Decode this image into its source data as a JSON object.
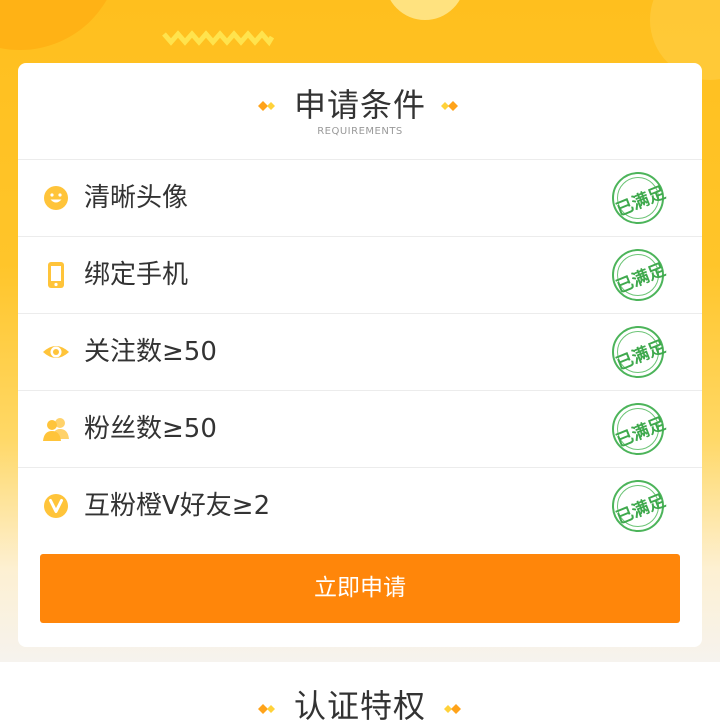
{
  "colors": {
    "accent": "#ff860a",
    "stamp_green": "#4cb45a",
    "icon_yellow": "#ffc43a",
    "hero_yellow": "#ffbf1e"
  },
  "requirements_card": {
    "title": "申请条件",
    "subtitle": "REQUIREMENTS",
    "items": [
      {
        "label": "清晰头像",
        "icon": "smiley-icon",
        "status": "已满足"
      },
      {
        "label": "绑定手机",
        "icon": "phone-icon",
        "status": "已满足"
      },
      {
        "label": "关注数≥50",
        "icon": "eye-icon",
        "status": "已满足"
      },
      {
        "label": "粉丝数≥50",
        "icon": "users-icon",
        "status": "已满足"
      },
      {
        "label": "互粉橙V好友≥2",
        "icon": "v-badge-icon",
        "status": "已满足"
      }
    ],
    "apply_button": "立即申请"
  },
  "privileges_section": {
    "title": "认证特权"
  }
}
